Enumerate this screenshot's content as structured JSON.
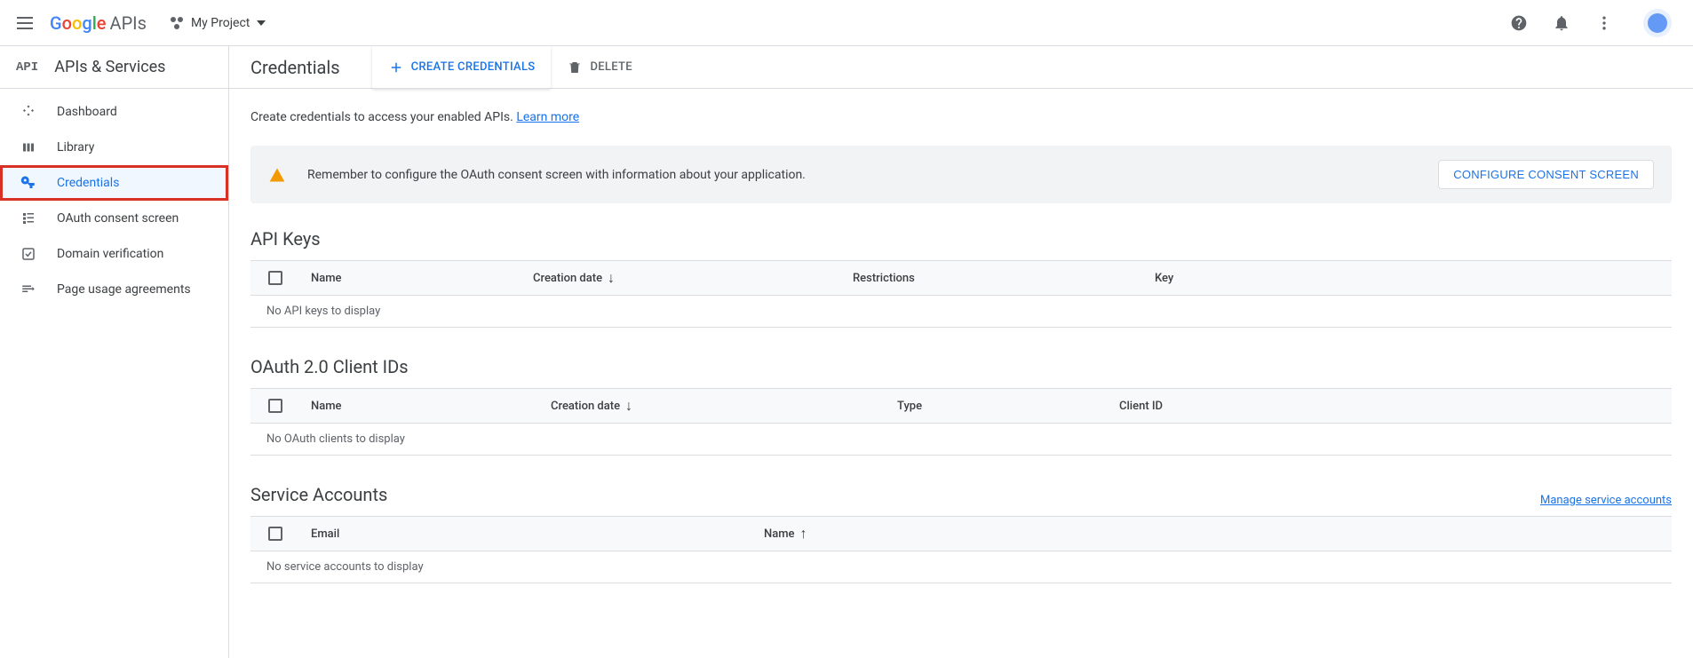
{
  "topbar": {
    "logo_text": "APIs",
    "project_name": "My Project"
  },
  "sidebar": {
    "title": "APIs & Services",
    "items": [
      {
        "label": "Dashboard"
      },
      {
        "label": "Library"
      },
      {
        "label": "Credentials"
      },
      {
        "label": "OAuth consent screen"
      },
      {
        "label": "Domain verification"
      },
      {
        "label": "Page usage agreements"
      }
    ]
  },
  "page": {
    "title": "Credentials",
    "actions": {
      "create": "CREATE CREDENTIALS",
      "delete": "DELETE"
    },
    "intro_text": "Create credentials to access your enabled APIs. ",
    "learn_more": "Learn more",
    "alert": {
      "message": "Remember to configure the OAuth consent screen with information about your application.",
      "button": "CONFIGURE CONSENT SCREEN"
    },
    "sections": {
      "api_keys": {
        "title": "API Keys",
        "columns": {
          "name": "Name",
          "creation": "Creation date",
          "restrictions": "Restrictions",
          "key": "Key"
        },
        "empty": "No API keys to display"
      },
      "oauth": {
        "title": "OAuth 2.0 Client IDs",
        "columns": {
          "name": "Name",
          "creation": "Creation date",
          "type": "Type",
          "client_id": "Client ID"
        },
        "empty": "No OAuth clients to display"
      },
      "service": {
        "title": "Service Accounts",
        "manage_link": "Manage service accounts",
        "columns": {
          "email": "Email",
          "name": "Name"
        },
        "empty": "No service accounts to display"
      }
    }
  }
}
